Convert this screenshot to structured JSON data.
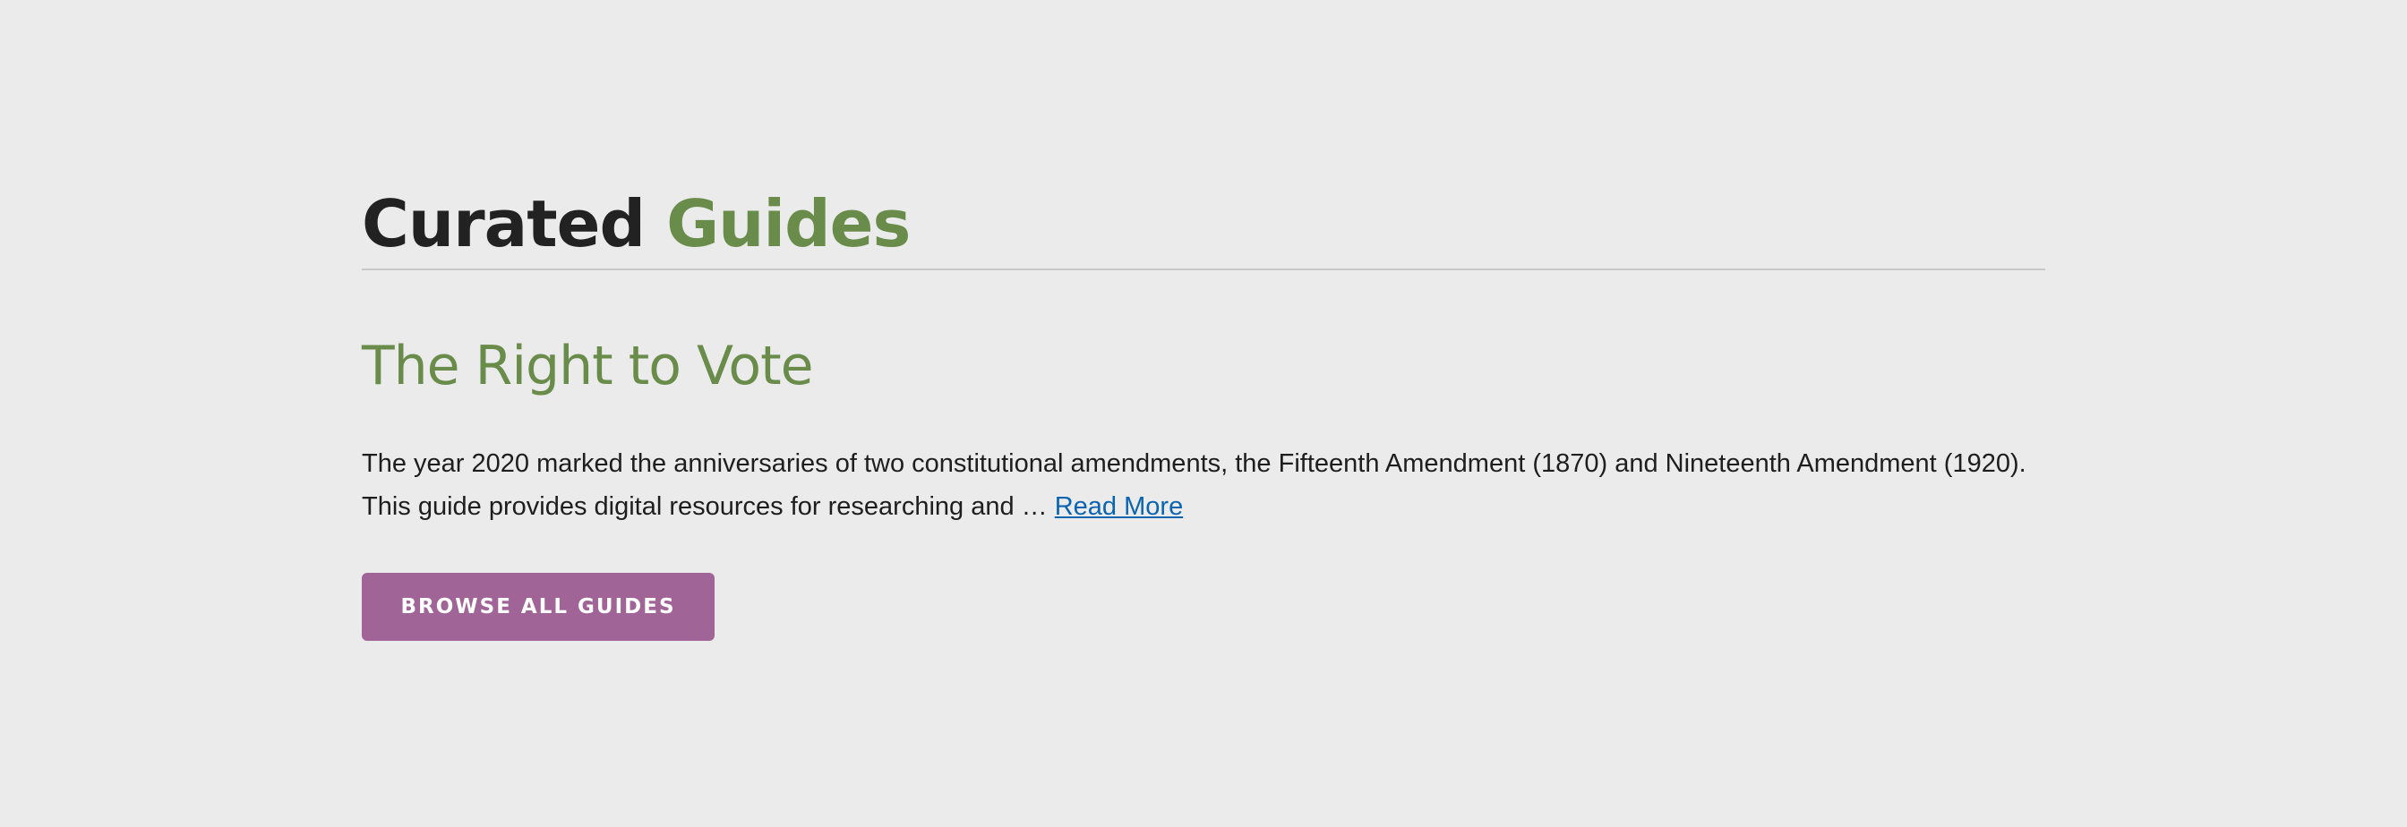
{
  "section": {
    "heading_primary": "Curated",
    "heading_accent": "Guides"
  },
  "guide": {
    "title": "The Right to Vote",
    "excerpt": "The year 2020 marked the anniversaries of two constitutional amendments, the Fifteenth Amendment (1870) and Nineteenth Amendment (1920). This guide provides digital resources for researching and …",
    "read_more_label": "Read More"
  },
  "actions": {
    "browse_label": "BROWSE ALL GUIDES"
  },
  "colors": {
    "background": "#ebebeb",
    "accent_green": "#6a8c4a",
    "link_blue": "#0a64b0",
    "button_purple": "#a06497"
  }
}
